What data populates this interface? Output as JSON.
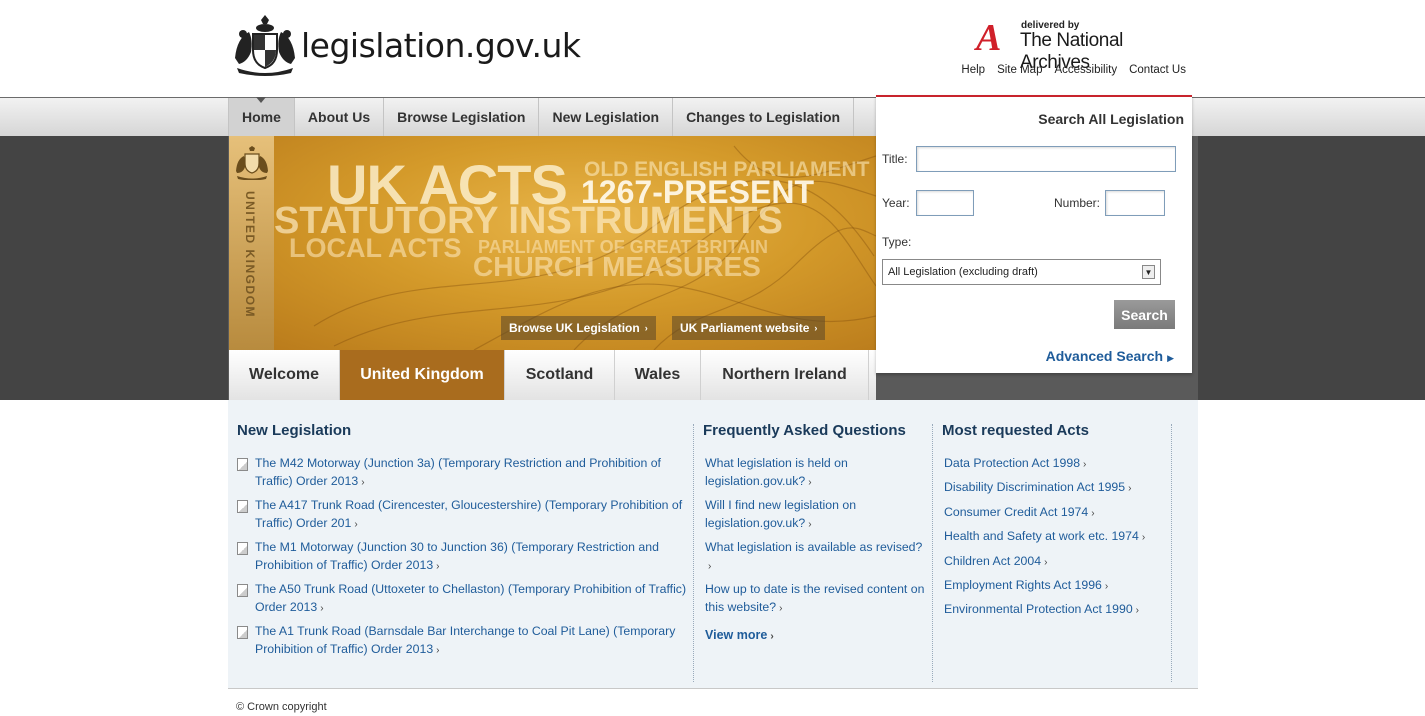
{
  "site": {
    "name": "legislation.gov.uk"
  },
  "tna": {
    "delivered_by": "delivered by",
    "letter": "A",
    "name": "The National Archives"
  },
  "utility_links": [
    "Help",
    "Site Map",
    "Accessibility",
    "Contact Us"
  ],
  "nav": [
    {
      "label": "Home",
      "active": true
    },
    {
      "label": "About Us"
    },
    {
      "label": "Browse Legislation"
    },
    {
      "label": "New Legislation"
    },
    {
      "label": "Changes to Legislation"
    }
  ],
  "banner": {
    "side_label": "UNITED KINGDOM",
    "words": [
      "UK ACTS",
      "OLD ENGLISH PARLIAMENT",
      "1267-PRESENT",
      "STATUTORY INSTRUMENTS",
      "LOCAL ACTS",
      "PARLIAMENT OF GREAT BRITAIN",
      "CHURCH MEASURES"
    ],
    "browse_button": "Browse UK Legislation",
    "parliament_button": "UK Parliament website"
  },
  "tabs": [
    "Welcome",
    "United Kingdom",
    "Scotland",
    "Wales",
    "Northern Ireland"
  ],
  "search": {
    "title": "Search All Legislation",
    "title_label": "Title:",
    "title_value": "",
    "year_label": "Year:",
    "year_value": "",
    "number_label": "Number:",
    "number_value": "",
    "type_label": "Type:",
    "type_selected": "All Legislation (excluding draft)",
    "button": "Search",
    "advanced": "Advanced Search"
  },
  "new_legislation": {
    "heading": "New Legislation",
    "items": [
      "The M42 Motorway (Junction 3a) (Temporary Restriction and Prohibition of Traffic) Order 2013",
      "The A417 Trunk Road (Cirencester, Gloucestershire) (Temporary Prohibition of Traffic) Order 201",
      "The M1 Motorway (Junction 30 to Junction 36) (Temporary Restriction and Prohibition of Traffic) Order 2013",
      "The A50 Trunk Road (Uttoxeter to Chellaston) (Temporary Prohibition of Traffic) Order 2013",
      "The A1 Trunk Road (Barnsdale Bar Interchange to Coal Pit Lane) (Temporary Prohibition of Traffic) Order 2013"
    ]
  },
  "faq": {
    "heading": "Frequently Asked Questions",
    "items": [
      "What legislation is held on legislation.gov.uk?",
      "Will I find new legislation on legislation.gov.uk?",
      "What legislation is available as revised?",
      "How up to date is the revised content on this website?"
    ],
    "view_more": "View more"
  },
  "acts": {
    "heading": "Most requested Acts",
    "items": [
      "Data Protection Act 1998",
      "Disability Discrimination Act 1995",
      "Consumer Credit Act 1974",
      "Health and Safety at work etc. 1974",
      "Children Act 2004",
      "Employment Rights Act 1996",
      "Environmental Protection Act 1990"
    ]
  },
  "footer": {
    "copyright": "© Crown copyright"
  },
  "colors": {
    "link": "#1f5c9a",
    "accent_red": "#c8232c",
    "banner_gold": "#d49a2a",
    "active_tab": "#a96c1e"
  }
}
